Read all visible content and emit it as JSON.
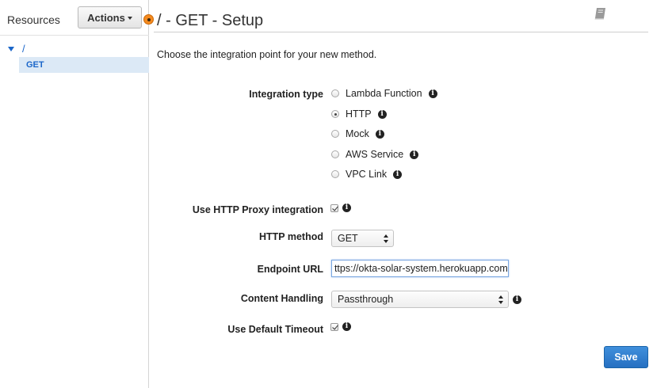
{
  "sidebar": {
    "title": "Resources",
    "actions_label": "Actions",
    "tree": {
      "root_label": "/",
      "child_label": "GET"
    }
  },
  "header": {
    "title": "/ - GET - Setup"
  },
  "intro": "Choose the integration point for your new method.",
  "form": {
    "integration_type": {
      "label": "Integration type",
      "selected": "HTTP",
      "options": [
        "Lambda Function",
        "HTTP",
        "Mock",
        "AWS Service",
        "VPC Link"
      ]
    },
    "http_proxy": {
      "label": "Use HTTP Proxy integration",
      "checked": true
    },
    "http_method": {
      "label": "HTTP method",
      "value": "GET"
    },
    "endpoint_url": {
      "label": "Endpoint URL",
      "value": "https://okta-solar-system.herokuapp.com"
    },
    "content_handling": {
      "label": "Content Handling",
      "value": "Passthrough"
    },
    "default_timeout": {
      "label": "Use Default Timeout",
      "checked": true
    }
  },
  "save_label": "Save",
  "icons": {
    "info": "info-icon",
    "book": "book-icon",
    "tree_caret": "caret-down-icon",
    "splitter": "splitter-handle-icon"
  },
  "colors": {
    "link_blue": "#1b66c9",
    "save_blue": "#2f80d1",
    "handle_orange": "#f58a1f",
    "selected_row": "#dce9f6"
  }
}
